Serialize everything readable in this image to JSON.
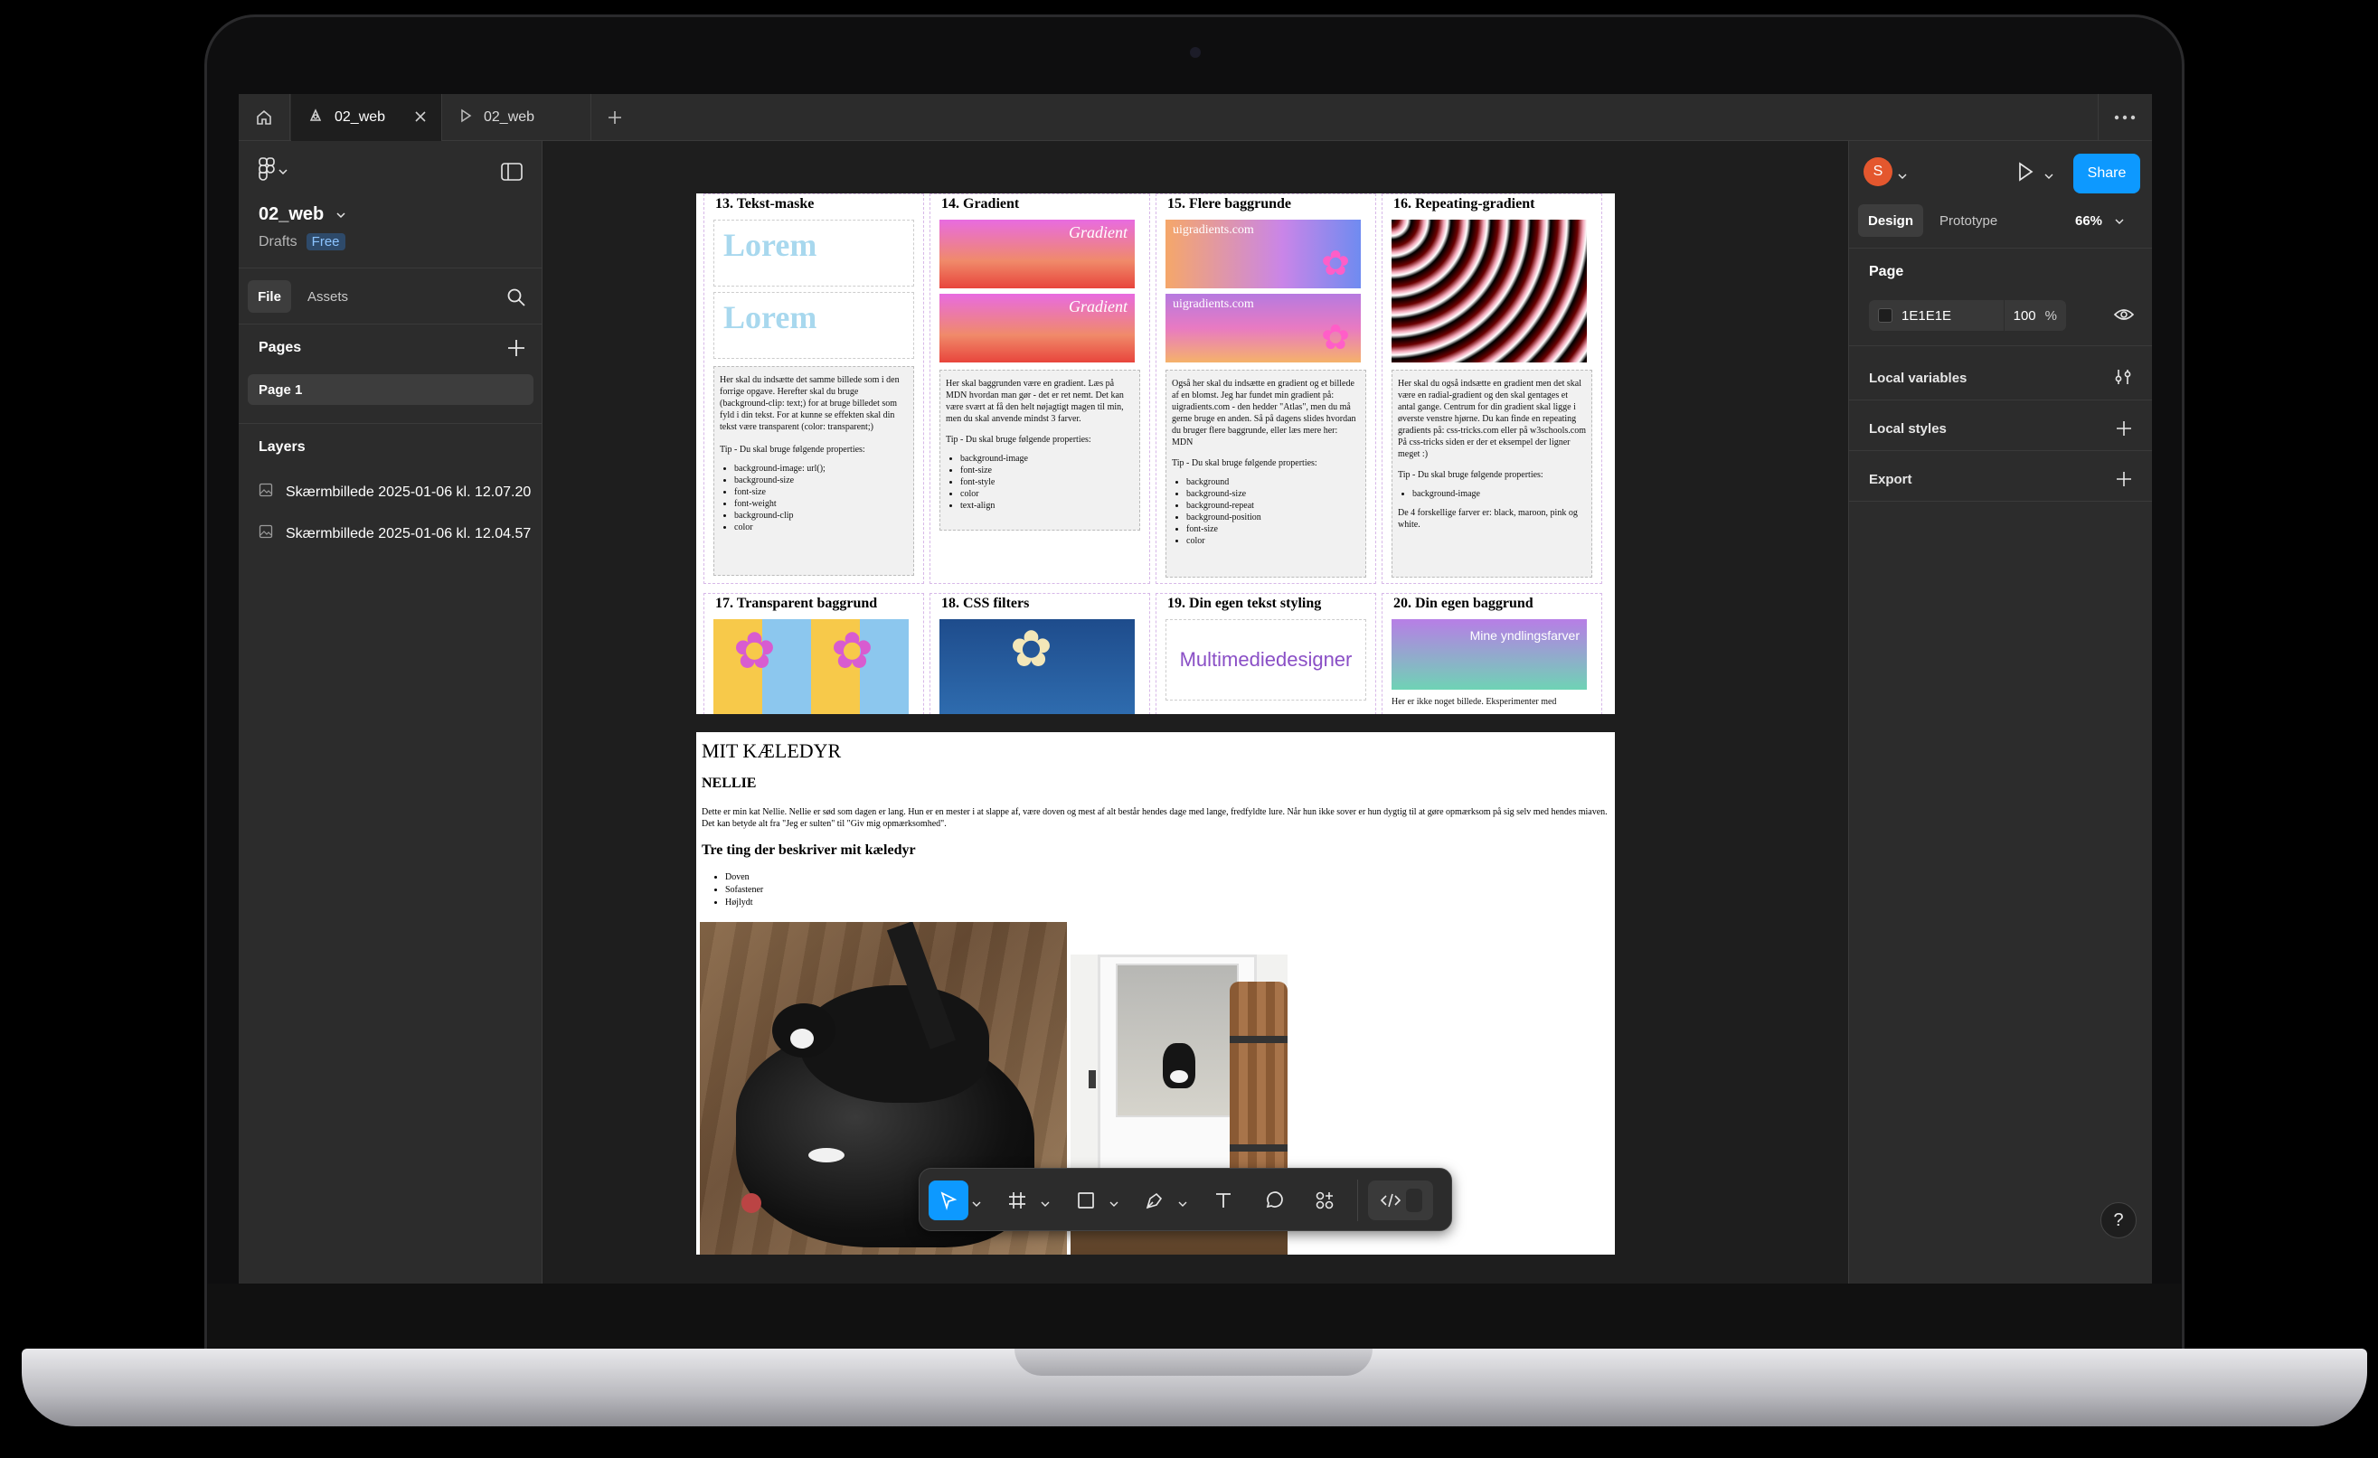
{
  "window": {
    "tabs": [
      {
        "label": "02_web",
        "icon": "figma-file-icon",
        "active": true
      },
      {
        "label": "02_web",
        "icon": "play-icon",
        "active": false
      }
    ]
  },
  "left_panel": {
    "file_name": "02_web",
    "drafts": "Drafts",
    "plan_badge": "Free",
    "tab_file": "File",
    "tab_assets": "Assets",
    "pages_title": "Pages",
    "pages": [
      "Page 1"
    ],
    "layers_title": "Layers",
    "layers": [
      "Skærmbillede 2025-01-06 kl. 12.07.20",
      "Skærmbillede 2025-01-06 kl. 12.04.57"
    ]
  },
  "right_panel": {
    "avatar_letter": "S",
    "share_label": "Share",
    "tab_design": "Design",
    "tab_prototype": "Prototype",
    "zoom": "66%",
    "page_title": "Page",
    "page_color": "1E1E1E",
    "page_opacity": "100",
    "percent": "%",
    "local_variables": "Local variables",
    "local_styles": "Local styles",
    "export": "Export",
    "colors": {
      "accent": "#0d99ff",
      "avatar": "#e4572e",
      "panel": "#2c2c2c",
      "canvas": "#1e1e1e"
    }
  },
  "frame1": {
    "cards": [
      {
        "title": "13. Tekst-maske",
        "preview1": "Lorem",
        "preview2": "Lorem",
        "text": "Her skal du indsætte det samme billede som i den forrige opgave. Herefter skal du bruge (background-clip: text;) for at bruge billedet som fyld i din tekst. For at kunne se effekten skal din tekst være transparent (color: transparent;)",
        "tip": "Tip - Du skal bruge følgende properties:",
        "list": [
          "background-image: url();",
          "background-size",
          "font-size",
          "font-weight",
          "background-clip",
          "color"
        ]
      },
      {
        "title": "14. Gradient",
        "preview1": "Gradient",
        "preview2": "Gradient",
        "text": "Her skal baggrunden være en gradient. Læs på MDN hvordan man gør - det er ret nemt. Det kan være svært at få den helt nøjagtigt magen til min, men du skal anvende mindst 3 farver.",
        "tip": "Tip - Du skal bruge følgende properties:",
        "list": [
          "background-image",
          "font-size",
          "font-style",
          "color",
          "text-align"
        ]
      },
      {
        "title": "15. Flere baggrunde",
        "preview1": "uigradients.com",
        "preview2": "uigradients.com",
        "text": "Også her skal du indsætte en gradient og et billede af en blomst. Jeg har fundet min gradient på: uigradients.com - den hedder \"Atlas\", men du må gerne bruge en anden. Så på dagens slides hvordan du bruger flere baggrunde, eller læs mere her: MDN",
        "tip": "Tip - Du skal bruge følgende properties:",
        "list": [
          "background",
          "background-size",
          "background-repeat",
          "background-position",
          "font-size",
          "color"
        ]
      },
      {
        "title": "16. Repeating-gradient",
        "text": "Her skal du også indsætte en gradient men det skal være en radial-gradient og den skal gentages et antal gange. Centrum for din gradient skal ligge i øverste venstre hjørne. Du kan finde en repeating gradients på: css-tricks.com eller på w3schools.com På css-tricks siden er der et eksempel der ligner meget :)",
        "tip": "Tip - Du skal bruge følgende properties:",
        "list": [
          "background-image"
        ],
        "extra": "De 4 forskellige farver er: black, maroon, pink og white."
      },
      {
        "title": "17. Transparent baggrund"
      },
      {
        "title": "18. CSS filters"
      },
      {
        "title": "19. Din egen tekst styling",
        "preview1": "Multimediedesigner"
      },
      {
        "title": "20. Din egen baggrund",
        "preview1": "Mine yndlingsfarver",
        "text": "Her er ikke noget billede. Eksperimenter med"
      }
    ]
  },
  "frame2": {
    "title": "MIT KÆLEDYR",
    "name": "NELLIE",
    "paragraph": "Dette er min kat Nellie. Nellie er sød som dagen er lang. Hun er en mester i at slappe af, være doven og mest af alt består hendes dage med lange, fredfyldte lure. Når hun ikke sover er hun dygtig til at gøre opmærksom på sig selv med hendes miaven. Det kan betyde alt fra \"Jeg er sulten\" til \"Giv mig opmærksomhed\".",
    "subtitle": "Tre ting der beskriver mit kæledyr",
    "list": [
      "Doven",
      "Sofastener",
      "Højlydt"
    ]
  },
  "toolbar": {
    "tools": [
      "move-icon",
      "frame-icon",
      "rectangle-icon",
      "pen-icon",
      "text-icon",
      "comment-icon",
      "actions-icon",
      "dev-mode-icon"
    ]
  },
  "help_label": "?"
}
